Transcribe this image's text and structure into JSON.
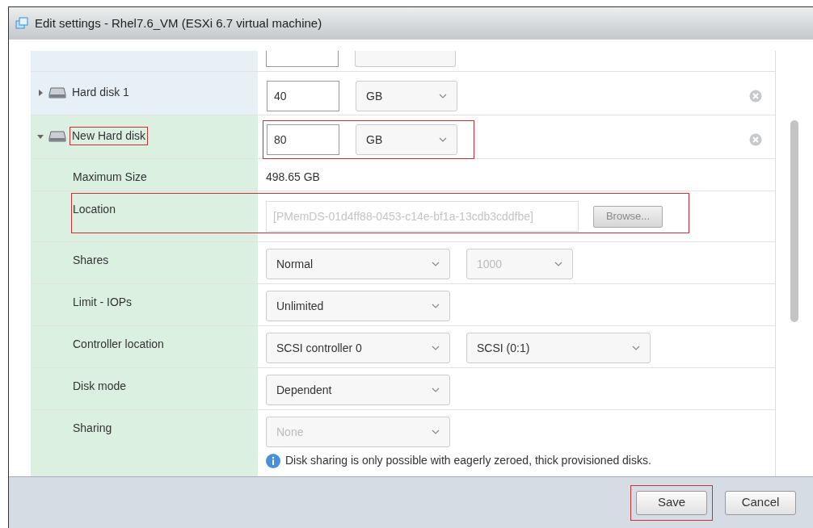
{
  "window": {
    "title": "Edit settings - Rhel7.6_VM (ESXi 6.7 virtual machine)"
  },
  "rows": [
    {
      "kind": "cut"
    },
    {
      "kind": "disk",
      "label": "Hard disk 1",
      "expanded": false,
      "size": "40",
      "unit": "GB",
      "highlighted": false
    },
    {
      "kind": "disk",
      "label": "New Hard disk",
      "expanded": true,
      "size": "80",
      "unit": "GB",
      "highlighted": true
    },
    {
      "kind": "text",
      "label": "Maximum Size",
      "value": "498.65 GB"
    },
    {
      "kind": "location",
      "label": "Location",
      "value": "[PMemDS-01d4ff88-0453-c14e-bf1a-13cdb3cddfbe]",
      "button": "Browse...",
      "disabled": true,
      "highlighted": true
    },
    {
      "kind": "selects",
      "label": "Shares",
      "selects": [
        {
          "value": "Normal",
          "disabled": false
        },
        {
          "value": "1000",
          "disabled": true
        }
      ]
    },
    {
      "kind": "selects",
      "label": "Limit - IOPs",
      "selects": [
        {
          "value": "Unlimited",
          "disabled": false
        }
      ]
    },
    {
      "kind": "selects",
      "label": "Controller location",
      "selects": [
        {
          "value": "SCSI controller 0",
          "disabled": false
        },
        {
          "value": "SCSI (0:1)",
          "disabled": false
        }
      ]
    },
    {
      "kind": "selects",
      "label": "Disk mode",
      "selects": [
        {
          "value": "Dependent",
          "disabled": false
        }
      ]
    },
    {
      "kind": "selects",
      "label": "Sharing",
      "selects": [
        {
          "value": "None",
          "disabled": true
        }
      ],
      "note": "Disk sharing is only possible with eagerly zeroed, thick provisioned disks."
    }
  ],
  "buttons": [
    {
      "label": "Save",
      "highlighted": true
    },
    {
      "label": "Cancel",
      "highlighted": false
    }
  ]
}
